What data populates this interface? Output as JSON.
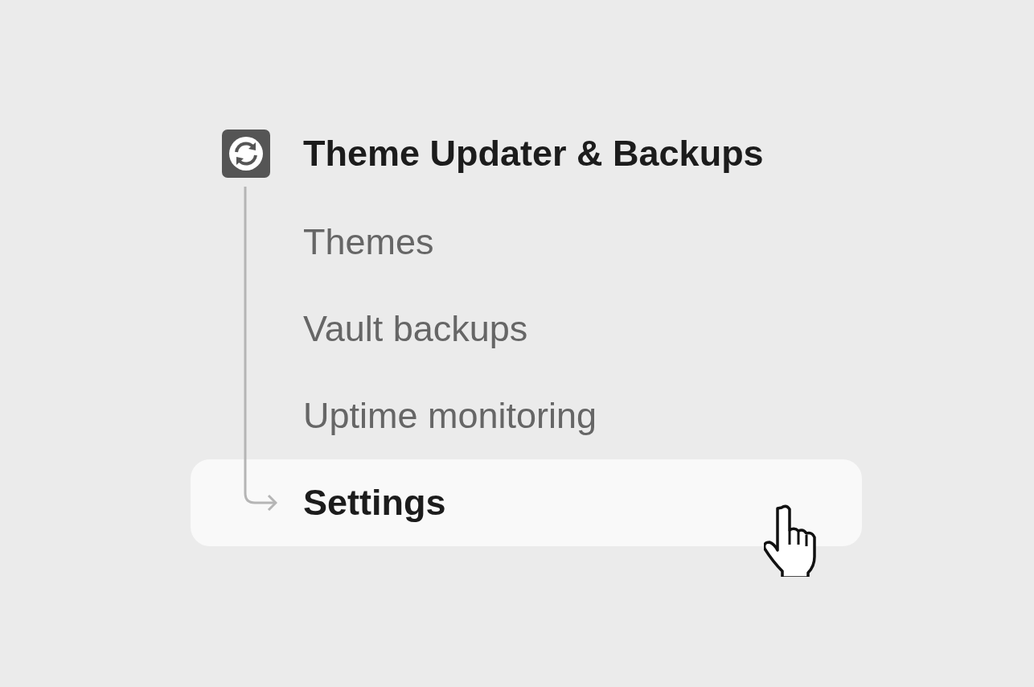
{
  "header": {
    "title": "Theme Updater & Backups"
  },
  "items": [
    {
      "label": "Themes",
      "selected": false
    },
    {
      "label": "Vault backups",
      "selected": false
    },
    {
      "label": "Uptime monitoring",
      "selected": false
    },
    {
      "label": "Settings",
      "selected": true
    }
  ]
}
